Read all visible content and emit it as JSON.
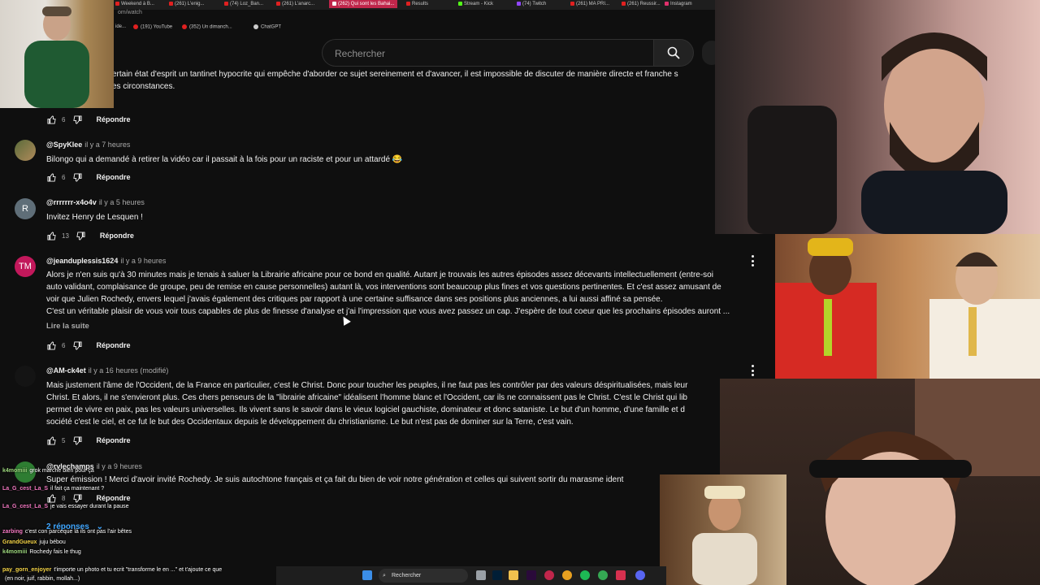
{
  "browser": {
    "tabs": [
      {
        "label": "Weekend à B...",
        "fav": "#e02020"
      },
      {
        "label": "(261) L'enig...",
        "fav": "#e02020"
      },
      {
        "label": "(74) Loz_Ban...",
        "fav": "#e02020"
      },
      {
        "label": "(261) L'anarc...",
        "fav": "#e02020"
      },
      {
        "label": "(262) Qui sont les Bahai...",
        "fav": "#ffffff",
        "active": true
      },
      {
        "label": "Results",
        "fav": "#e02020"
      },
      {
        "label": "Stream - Kick",
        "fav": "#53fc18"
      },
      {
        "label": "(74) Twitch",
        "fav": "#9146ff"
      },
      {
        "label": "(261) MA PRI...",
        "fav": "#e02020"
      },
      {
        "label": "(261) Reussir...",
        "fav": "#e02020"
      },
      {
        "label": "Instagram",
        "fav": "#e1306c"
      }
    ],
    "url": "om/watch",
    "bookmarks": [
      "ide...",
      "(191) YouTube",
      "(352) Un dimanch...",
      "ChatGPT"
    ]
  },
  "search": {
    "placeholder": "Rechercher"
  },
  "comments": [
    {
      "lines": [
        "ertain état d'esprit un tantinet hypocrite qui empêche d'aborder ce sujet sereinement et d'avancer, il est impossible de discuter de manière directe et franche s",
        "es circonstances."
      ],
      "likes": "6",
      "reply": "Répondre"
    },
    {
      "handle": "@SpyKlee",
      "time": "il y a 7 heures",
      "lines": [
        "Bilongo qui a demandé à retirer la vidéo car il passait à la fois pour un raciste et pour un attardé 😂"
      ],
      "likes": "6",
      "reply": "Répondre"
    },
    {
      "handle": "@rrrrrrr-x4o4v",
      "time": "il y a 5 heures",
      "avatar": "R",
      "lines": [
        "Invitez Henry de Lesquen !"
      ],
      "likes": "13",
      "reply": "Répondre"
    },
    {
      "handle": "@jeanduplessis1624",
      "time": "il y a 9 heures",
      "avatar": "TM",
      "lines": [
        "Alors je n'en suis qu'à 30 minutes mais je tenais à saluer la Librairie africaine pour ce bond en qualité. Autant je trouvais les autres épisodes assez décevants intellectuellement (entre-soi",
        "auto validant, complaisance de groupe, peu de remise en cause personnelles) autant là, vos interventions sont beaucoup plus fines et vos questions pertinentes. Et c'est assez amusant de",
        "voir que Julien Rochedy, envers lequel j'avais également des critiques par rapport à une certaine suffisance dans ses positions plus anciennes, a lui aussi affiné sa pensée.",
        "C'est un véritable plaisir de vous voir tous capables de plus de finesse d'analyse et j'ai l'impression que vous avez passez un cap. J'espère de tout coeur que les prochains épisodes auront ..."
      ],
      "readmore": "Lire la suite",
      "likes": "6",
      "reply": "Répondre"
    },
    {
      "handle": "@AM-ck4et",
      "time": "il y a 16 heures (modifié)",
      "lines": [
        "Mais justement l'âme de l'Occident, de la France en particulier, c'est le Christ. Donc pour toucher les peuples, il ne faut pas les contrôler par des valeurs déspiritualisées, mais leur",
        "Christ. Et alors, il ne s'envieront plus. Ces chers penseurs de la \"librairie africaine\" idéalisent l'homme blanc et l'Occident, car ils ne connaissent pas le Christ. C'est le Christ qui lib",
        "permet de vivre en paix, pas les valeurs universelles. Ils vivent sans le savoir dans le vieux logiciel gauchiste, dominateur et donc sataniste. Le but d'un homme, d'une famille et d",
        "société c'est le ciel, et ce fut le but des Occidentaux depuis le développement du christianisme. Le but n'est pas de dominer sur la Terre, c'est vain."
      ],
      "likes": "5",
      "reply": "Répondre"
    },
    {
      "handle": "@rvlechamps",
      "time": "il y a 9 heures",
      "lines": [
        "Super émission ! Merci d'avoir invité Rochedy. Je suis autochtone français et ça fait du bien de voir notre génération et celles qui suivent sortir du marasme ident"
      ],
      "likes": "8",
      "reply": "Répondre",
      "replies": "2 réponses"
    }
  ],
  "chat": [
    {
      "user": "k4momiii",
      "text": "grok marche bien pour ça",
      "color": "green"
    },
    {
      "user": "La_G_cest_La_S",
      "text": "il fait ça maintenant ?",
      "color": "pink"
    },
    {
      "user": "La_G_cest_La_S",
      "text": "je vais essayer durant la pause",
      "color": "pink"
    },
    {
      "user": "zarbing",
      "text": "c'est con parceque là ils ont pas l'air bêtes",
      "color": "pink"
    },
    {
      "user": "GrandGueux",
      "text": "juju bébou",
      "color": "yellow"
    },
    {
      "user": "k4momiii",
      "text": "Rochedy fais le thug",
      "color": "green"
    },
    {
      "user": "pay_gorn_enjoyer",
      "text": "t'importe un photo et tu ecrit \"transforme le en ...\" et t'ajoute ce que",
      "color": "yellow"
    },
    {
      "user": "",
      "text": "(en noir, juif, rabbin, mollah...)",
      "color": "teal"
    }
  ],
  "taskbar": {
    "search_label": "Rechercher"
  }
}
